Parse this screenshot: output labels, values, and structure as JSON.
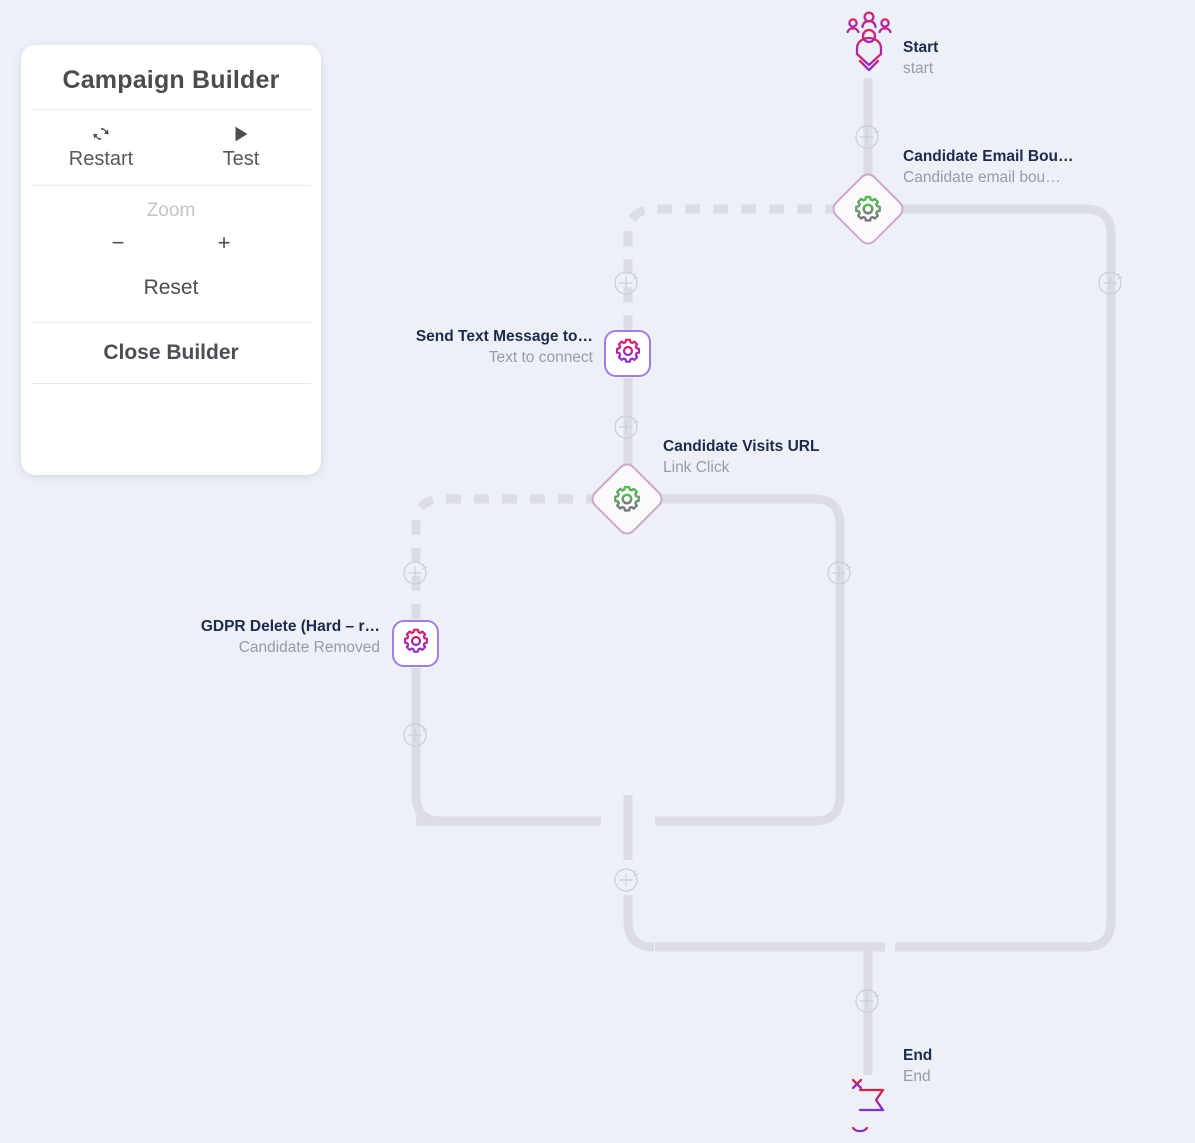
{
  "panel": {
    "title": "Campaign Builder",
    "buttons": [
      {
        "label": "Restart",
        "icon": "refresh-icon"
      },
      {
        "label": "Test",
        "icon": "play-icon"
      }
    ],
    "zoom": {
      "label": "Zoom",
      "minus": "−",
      "plus": "+",
      "reset": "Reset"
    },
    "close": "Close Builder"
  },
  "flow": {
    "nodes": [
      {
        "id": "start",
        "title": "Start",
        "subtitle": "start",
        "shape": "icon",
        "icon": "audience-funnel-icon",
        "label_side": "right"
      },
      {
        "id": "candidate-email-bounced",
        "title": "Candidate Email Bou…",
        "subtitle": "Candidate email bou…",
        "shape": "diamond",
        "icon": "gear-icon-green",
        "label_side": "right"
      },
      {
        "id": "send-text-message",
        "title": "Send Text Message to…",
        "subtitle": "Text to connect",
        "shape": "square",
        "icon": "gear-icon-magenta",
        "label_side": "left"
      },
      {
        "id": "candidate-visits-url",
        "title": "Candidate Visits URL",
        "subtitle": "Link Click",
        "shape": "diamond",
        "icon": "gear-icon-green",
        "label_side": "right"
      },
      {
        "id": "gdpr-delete",
        "title": "GDPR Delete (Hard – r…",
        "subtitle": "Candidate Removed",
        "shape": "square",
        "icon": "gear-icon-magenta",
        "label_side": "left"
      },
      {
        "id": "end",
        "title": "End",
        "subtitle": "End",
        "shape": "icon",
        "icon": "flag-end-icon",
        "label_side": "right"
      }
    ],
    "add_buttons": [
      {
        "id": "add-after-start"
      },
      {
        "id": "add-before-send-text"
      },
      {
        "id": "add-after-send-text"
      },
      {
        "id": "add-right-branch-top"
      },
      {
        "id": "add-before-gdpr"
      },
      {
        "id": "add-right-branch-mid"
      },
      {
        "id": "add-after-gdpr"
      },
      {
        "id": "add-merge"
      },
      {
        "id": "add-before-end"
      }
    ]
  },
  "colors": {
    "background": "#edf0f7",
    "edge": "#dcdce4",
    "node_title": "#1d2a4d",
    "node_subtitle": "#9a9aa6",
    "diamond_border": "#cda7cd",
    "square_border": "#a07de4",
    "gear_green_start": "#4fc04f",
    "gear_green_end": "#6b6b6b",
    "gear_magenta_start": "#e01e5a",
    "gear_magenta_end": "#8b2fd6",
    "panel_text": "#4d4d53"
  }
}
